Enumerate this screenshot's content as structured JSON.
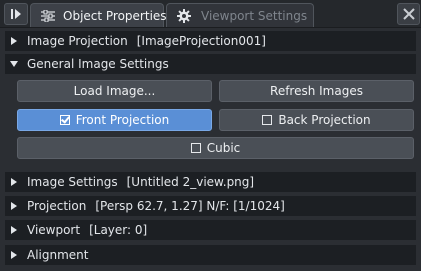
{
  "tabs": [
    {
      "label": "Object Properties",
      "icon": "sliders-icon",
      "active": true
    },
    {
      "label": "Viewport Settings",
      "icon": "gear-icon",
      "active": false
    }
  ],
  "sections": {
    "image_projection": {
      "title": "Image Projection",
      "value": "[ImageProjection001]",
      "expanded": false
    },
    "general": {
      "title": "General Image Settings",
      "expanded": true
    },
    "image_settings": {
      "title": "Image Settings",
      "value": "[Untitled 2_view.png]",
      "expanded": false
    },
    "projection": {
      "title": "Projection",
      "value": "[Persp 62.7, 1.27] N/F: [1/1024]",
      "expanded": false
    },
    "viewport": {
      "title": "Viewport",
      "value": "[Layer: 0]",
      "expanded": false
    },
    "alignment": {
      "title": "Alignment",
      "expanded": false
    }
  },
  "buttons": {
    "load_images": "Load Image...",
    "refresh_images": "Refresh Images",
    "front_projection": {
      "label": "Front Projection",
      "checked": true
    },
    "back_projection": {
      "label": "Back Projection",
      "checked": false
    },
    "cubic": {
      "label": "Cubic",
      "checked": false
    }
  },
  "colors": {
    "accent": "#5a8fd6",
    "background": "#2b2e33",
    "section_header": "#1c1f23",
    "button": "#4a4f56"
  }
}
